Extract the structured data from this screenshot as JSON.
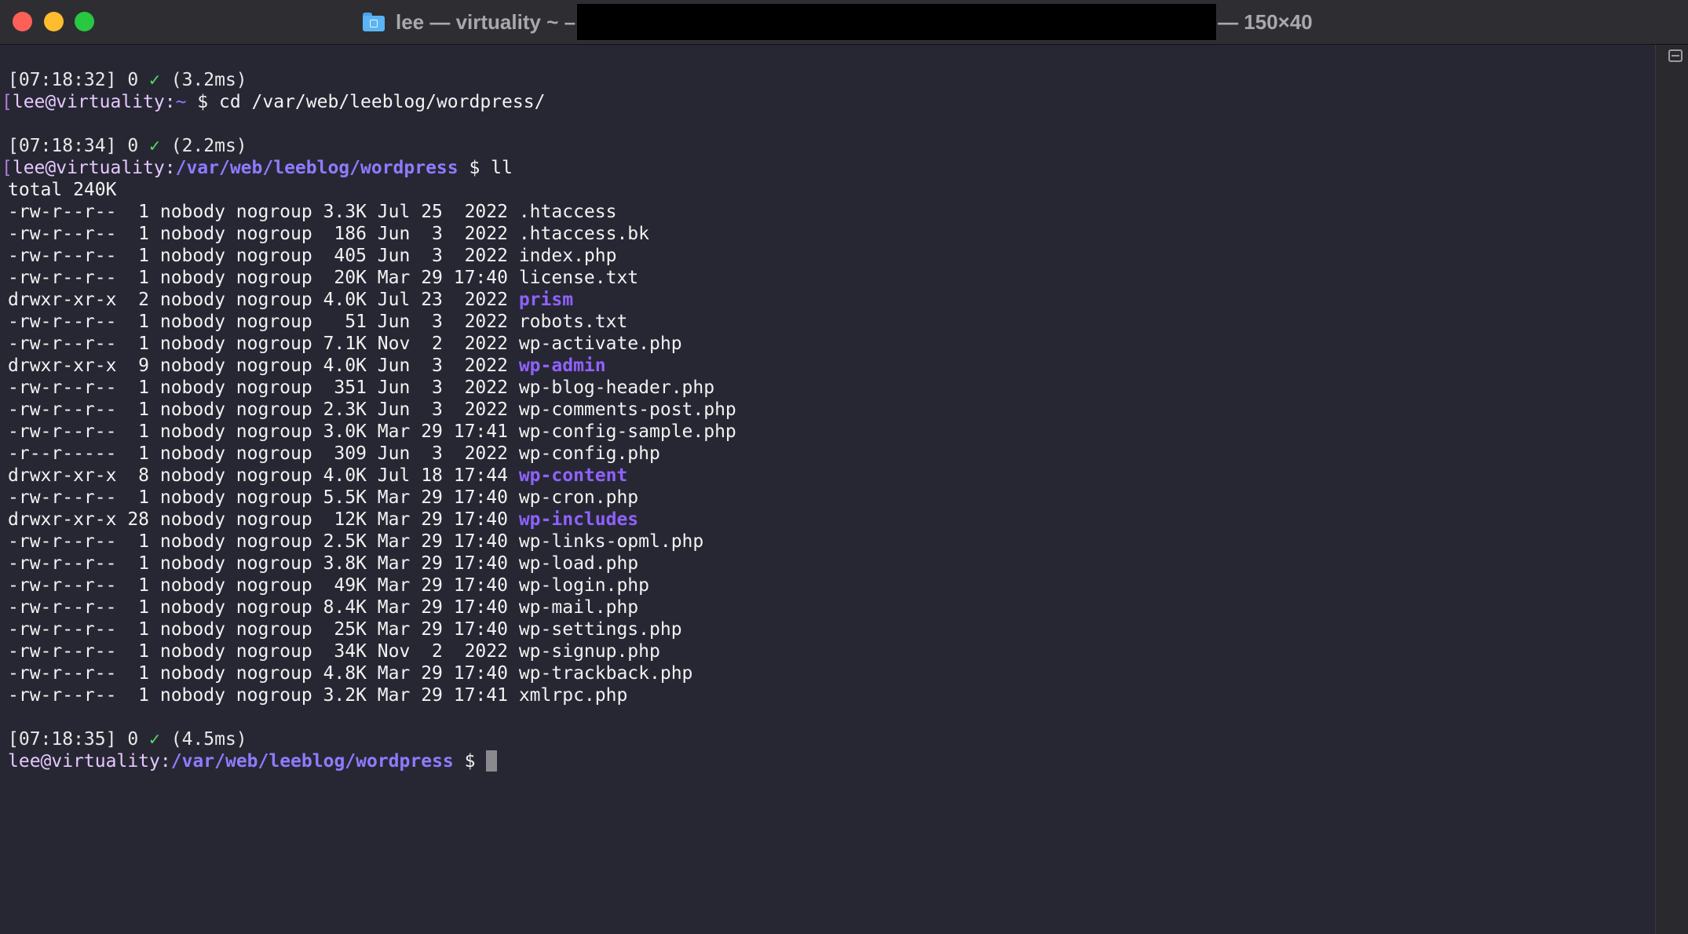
{
  "window": {
    "title_left": "lee — virtuality ~ –",
    "title_right": "— 150×40",
    "title_icon": "home-folder-icon"
  },
  "colors": {
    "background": "#272734",
    "check": "#55d65e",
    "path": "#8f7bff",
    "directory": "#8f62ff",
    "user": "#e6c8ff"
  },
  "terminal": {
    "status1": {
      "time": "[07:18:32] 0 ",
      "check": "✓",
      "duration": " (3.2ms)"
    },
    "prompt1": {
      "open": "[",
      "user": "lee@virtuality",
      "colon": ":",
      "path": "~",
      "command": " $ cd /var/web/leeblog/wordpress/",
      "close": "]"
    },
    "status2": {
      "time": "[07:18:34] 0 ",
      "check": "✓",
      "duration": " (2.2ms)"
    },
    "prompt2": {
      "open": "[",
      "user": "lee@virtuality",
      "colon": ":",
      "path": "/var/web/leeblog/wordpress",
      "command": " $ ll",
      "close": "]"
    },
    "total": "total 240K",
    "listing": [
      {
        "info": "-rw-r--r--  1 nobody nogroup 3.3K Jul 25  2022 ",
        "name": ".htaccess",
        "dir": false
      },
      {
        "info": "-rw-r--r--  1 nobody nogroup  186 Jun  3  2022 ",
        "name": ".htaccess.bk",
        "dir": false
      },
      {
        "info": "-rw-r--r--  1 nobody nogroup  405 Jun  3  2022 ",
        "name": "index.php",
        "dir": false
      },
      {
        "info": "-rw-r--r--  1 nobody nogroup  20K Mar 29 17:40 ",
        "name": "license.txt",
        "dir": false
      },
      {
        "info": "drwxr-xr-x  2 nobody nogroup 4.0K Jul 23  2022 ",
        "name": "prism",
        "dir": true
      },
      {
        "info": "-rw-r--r--  1 nobody nogroup   51 Jun  3  2022 ",
        "name": "robots.txt",
        "dir": false
      },
      {
        "info": "-rw-r--r--  1 nobody nogroup 7.1K Nov  2  2022 ",
        "name": "wp-activate.php",
        "dir": false
      },
      {
        "info": "drwxr-xr-x  9 nobody nogroup 4.0K Jun  3  2022 ",
        "name": "wp-admin",
        "dir": true
      },
      {
        "info": "-rw-r--r--  1 nobody nogroup  351 Jun  3  2022 ",
        "name": "wp-blog-header.php",
        "dir": false
      },
      {
        "info": "-rw-r--r--  1 nobody nogroup 2.3K Jun  3  2022 ",
        "name": "wp-comments-post.php",
        "dir": false
      },
      {
        "info": "-rw-r--r--  1 nobody nogroup 3.0K Mar 29 17:41 ",
        "name": "wp-config-sample.php",
        "dir": false
      },
      {
        "info": "-r--r-----  1 nobody nogroup  309 Jun  3  2022 ",
        "name": "wp-config.php",
        "dir": false
      },
      {
        "info": "drwxr-xr-x  8 nobody nogroup 4.0K Jul 18 17:44 ",
        "name": "wp-content",
        "dir": true
      },
      {
        "info": "-rw-r--r--  1 nobody nogroup 5.5K Mar 29 17:40 ",
        "name": "wp-cron.php",
        "dir": false
      },
      {
        "info": "drwxr-xr-x 28 nobody nogroup  12K Mar 29 17:40 ",
        "name": "wp-includes",
        "dir": true
      },
      {
        "info": "-rw-r--r--  1 nobody nogroup 2.5K Mar 29 17:40 ",
        "name": "wp-links-opml.php",
        "dir": false
      },
      {
        "info": "-rw-r--r--  1 nobody nogroup 3.8K Mar 29 17:40 ",
        "name": "wp-load.php",
        "dir": false
      },
      {
        "info": "-rw-r--r--  1 nobody nogroup  49K Mar 29 17:40 ",
        "name": "wp-login.php",
        "dir": false
      },
      {
        "info": "-rw-r--r--  1 nobody nogroup 8.4K Mar 29 17:40 ",
        "name": "wp-mail.php",
        "dir": false
      },
      {
        "info": "-rw-r--r--  1 nobody nogroup  25K Mar 29 17:40 ",
        "name": "wp-settings.php",
        "dir": false
      },
      {
        "info": "-rw-r--r--  1 nobody nogroup  34K Nov  2  2022 ",
        "name": "wp-signup.php",
        "dir": false
      },
      {
        "info": "-rw-r--r--  1 nobody nogroup 4.8K Mar 29 17:40 ",
        "name": "wp-trackback.php",
        "dir": false
      },
      {
        "info": "-rw-r--r--  1 nobody nogroup 3.2K Mar 29 17:41 ",
        "name": "xmlrpc.php",
        "dir": false
      }
    ],
    "status3": {
      "time": "[07:18:35] 0 ",
      "check": "✓",
      "duration": " (4.5ms)"
    },
    "prompt3": {
      "user": "lee@virtuality",
      "colon": ":",
      "path": "/var/web/leeblog/wordpress",
      "command": " $ "
    }
  }
}
